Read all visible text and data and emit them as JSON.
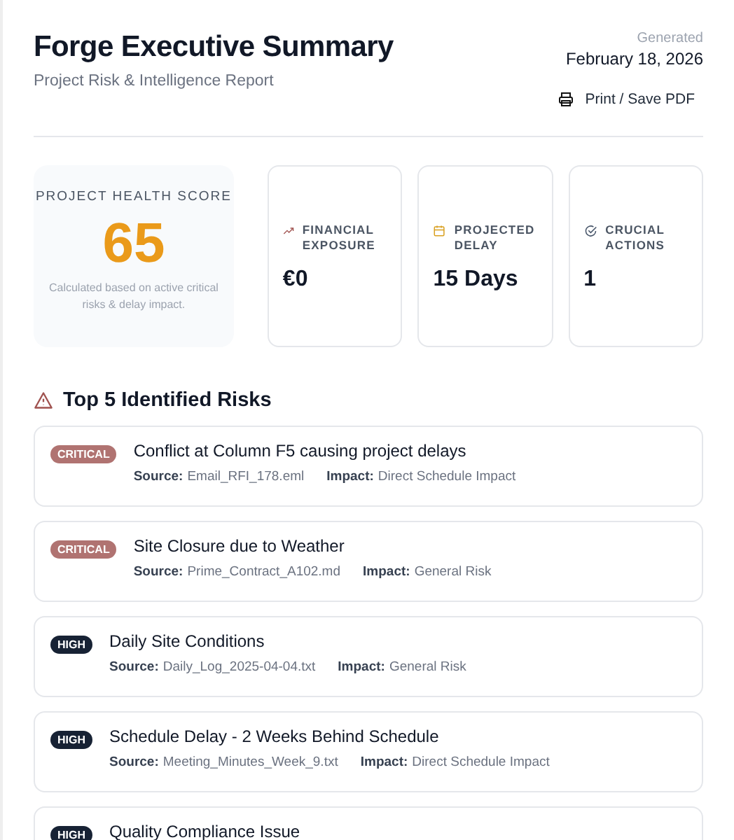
{
  "header": {
    "title": "Forge Executive Summary",
    "subtitle": "Project Risk & Intelligence Report",
    "generated_label": "Generated",
    "generated_date": "February 18, 2026",
    "print_button": "Print / Save PDF"
  },
  "health": {
    "label": "PROJECT HEALTH SCORE",
    "score": "65",
    "note": "Calculated based on active critical risks & delay impact."
  },
  "stats": [
    {
      "kind": "trend",
      "label": "FINANCIAL EXPOSURE",
      "value": "€0"
    },
    {
      "kind": "calendar",
      "label": "PROJECTED DELAY",
      "value": "15 Days"
    },
    {
      "kind": "check",
      "label": "CRUCIAL ACTIONS",
      "value": "1"
    }
  ],
  "risks_title": "Top 5 Identified Risks",
  "risks": [
    {
      "kind": "critical",
      "badge": "CRITICAL",
      "title": "Conflict at Column F5 causing project delays",
      "source_label": "Source:",
      "source": "Email_RFI_178.eml",
      "impact_label": "Impact:",
      "impact": "Direct Schedule Impact"
    },
    {
      "kind": "critical",
      "badge": "CRITICAL",
      "title": "Site Closure due to Weather",
      "source_label": "Source:",
      "source": "Prime_Contract_A102.md",
      "impact_label": "Impact:",
      "impact": "General Risk"
    },
    {
      "kind": "high",
      "badge": "HIGH",
      "title": "Daily Site Conditions",
      "source_label": "Source:",
      "source": "Daily_Log_2025-04-04.txt",
      "impact_label": "Impact:",
      "impact": "General Risk"
    },
    {
      "kind": "high",
      "badge": "HIGH",
      "title": "Schedule Delay - 2 Weeks Behind Schedule",
      "source_label": "Source:",
      "source": "Meeting_Minutes_Week_9.txt",
      "impact_label": "Impact:",
      "impact": "Direct Schedule Impact"
    },
    {
      "kind": "high",
      "badge": "HIGH",
      "title": "Quality Compliance Issue"
    }
  ]
}
